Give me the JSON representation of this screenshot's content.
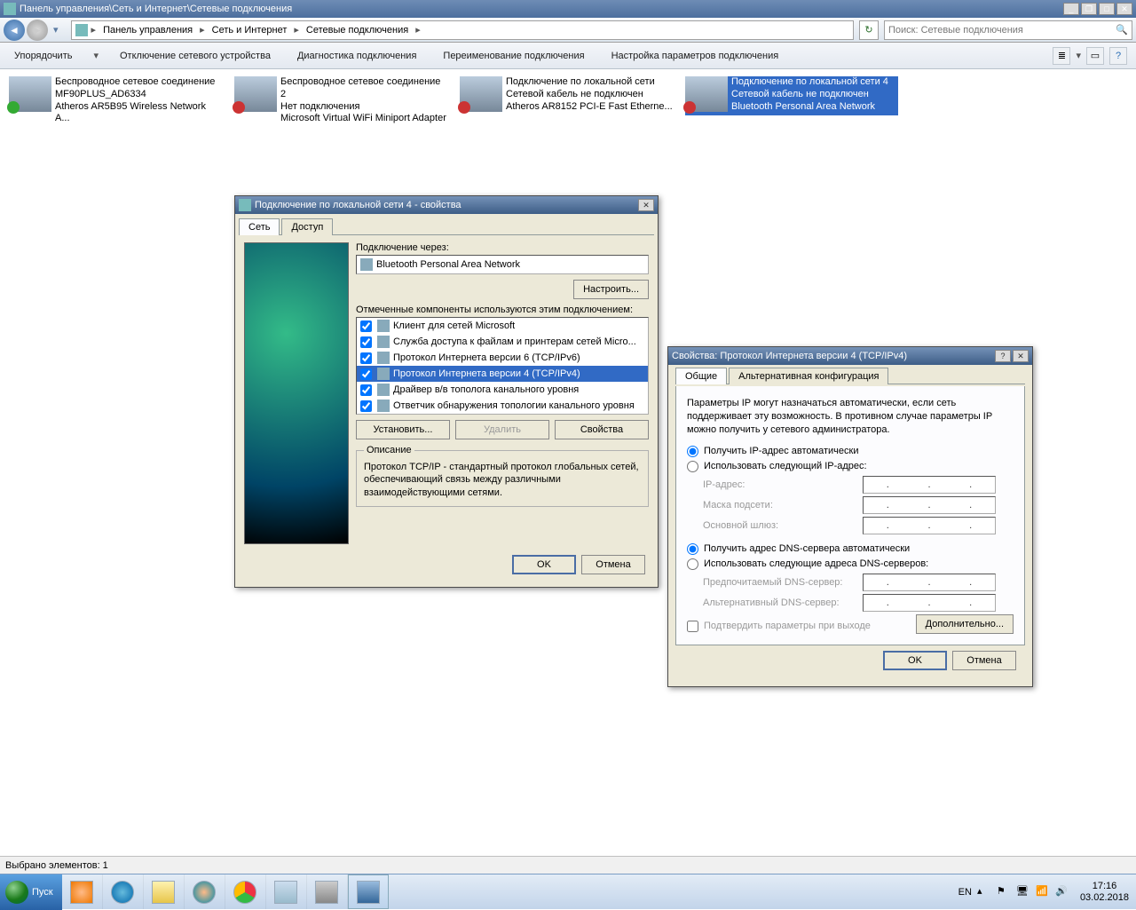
{
  "titlebar": {
    "path": "Панель управления\\Сеть и Интернет\\Сетевые подключения"
  },
  "navpath": {
    "parts": [
      "Панель управления",
      "Сеть и Интернет",
      "Сетевые подключения"
    ]
  },
  "search": {
    "placeholder": "Поиск: Сетевые подключения"
  },
  "toolbar": {
    "organize": "Упорядочить",
    "disable": "Отключение сетевого устройства",
    "diagnose": "Диагностика подключения",
    "rename": "Переименование подключения",
    "settings": "Настройка параметров подключения"
  },
  "connections": [
    {
      "name": "Беспроводное сетевое соединение",
      "status": "MF90PLUS_AD6334",
      "device": "Atheros AR5B95 Wireless Network A...",
      "ok": true
    },
    {
      "name": "Беспроводное сетевое соединение 2",
      "status": "Нет подключения",
      "device": "Microsoft Virtual WiFi Miniport Adapter",
      "ok": false
    },
    {
      "name": "Подключение по локальной сети",
      "status": "Сетевой кабель не подключен",
      "device": "Atheros AR8152 PCI-E Fast Etherne...",
      "ok": false
    },
    {
      "name": "Подключение по локальной сети 4",
      "status": "Сетевой кабель не подключен",
      "device": "Bluetooth Personal Area Network",
      "ok": false,
      "selected": true
    }
  ],
  "dlg1": {
    "title": "Подключение по локальной сети 4 - свойства",
    "tabs": {
      "net": "Сеть",
      "access": "Доступ"
    },
    "connect_via_label": "Подключение через:",
    "device": "Bluetooth Personal Area Network",
    "configure": "Настроить...",
    "components_label": "Отмеченные компоненты используются этим подключением:",
    "components": [
      "Клиент для сетей Microsoft",
      "Служба доступа к файлам и принтерам сетей Micro...",
      "Протокол Интернета версии 6 (TCP/IPv6)",
      "Протокол Интернета версии 4 (TCP/IPv4)",
      "Драйвер в/в тополога канального уровня",
      "Ответчик обнаружения топологии канального уровня"
    ],
    "selected_component": 3,
    "install": "Установить...",
    "uninstall": "Удалить",
    "properties": "Свойства",
    "desc_title": "Описание",
    "desc_text": "Протокол TCP/IP - стандартный протокол глобальных сетей, обеспечивающий связь между различными взаимодействующими сетями.",
    "ok": "OK",
    "cancel": "Отмена"
  },
  "dlg2": {
    "title": "Свойства: Протокол Интернета версии 4 (TCP/IPv4)",
    "tabs": {
      "general": "Общие",
      "alt": "Альтернативная конфигурация"
    },
    "intro": "Параметры IP могут назначаться автоматически, если сеть поддерживает эту возможность. В противном случае параметры IP можно получить у сетевого администратора.",
    "auto_ip": "Получить IP-адрес автоматически",
    "use_ip": "Использовать следующий IP-адрес:",
    "ip_label": "IP-адрес:",
    "mask_label": "Маска подсети:",
    "gw_label": "Основной шлюз:",
    "auto_dns": "Получить адрес DNS-сервера автоматически",
    "use_dns": "Использовать следующие адреса DNS-серверов:",
    "dns1_label": "Предпочитаемый DNS-сервер:",
    "dns2_label": "Альтернативный DNS-сервер:",
    "confirm": "Подтвердить параметры при выходе",
    "advanced": "Дополнительно...",
    "ok": "OK",
    "cancel": "Отмена"
  },
  "status": {
    "text": "Выбрано элементов: 1"
  },
  "taskbar": {
    "start": "Пуск",
    "lang": "EN",
    "time": "17:16",
    "date": "03.02.2018"
  }
}
